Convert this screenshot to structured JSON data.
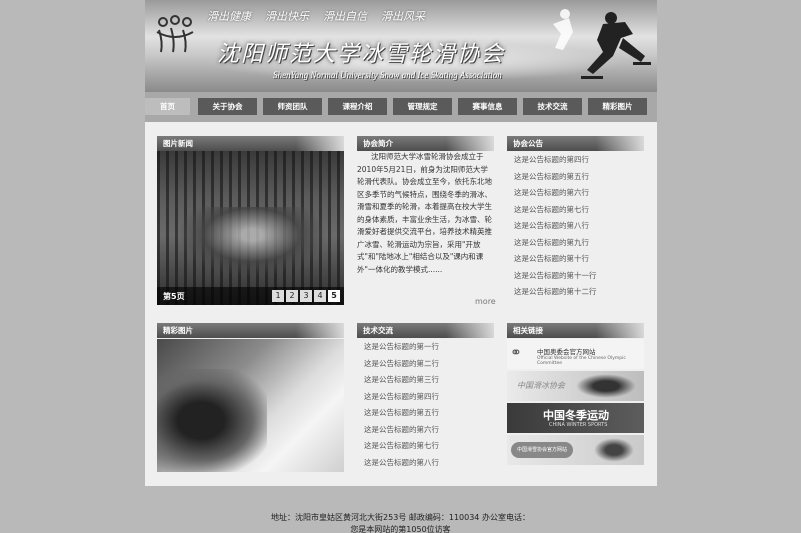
{
  "banner": {
    "slogans": [
      "滑出健康",
      "滑出快乐",
      "滑出自信",
      "滑出风采"
    ],
    "title": "沈阳师范大学冰雪轮滑协会",
    "subtitle": "ShenYang Normal University Snow and Ice Skating Association"
  },
  "nav": {
    "items": [
      {
        "label": "首页",
        "active": true
      },
      {
        "label": "关于协会"
      },
      {
        "label": "师资团队"
      },
      {
        "label": "课程介绍"
      },
      {
        "label": "管理规定"
      },
      {
        "label": "赛事信息"
      },
      {
        "label": "技术交流"
      },
      {
        "label": "精彩图片"
      }
    ]
  },
  "news_photo": {
    "heading": "图片新闻",
    "page_label": "第5页",
    "pages": [
      "1",
      "2",
      "3",
      "4",
      "5"
    ]
  },
  "intro": {
    "heading": "协会简介",
    "text": "沈阳师范大学冰雪轮滑协会成立于2010年5月21日，前身为沈阳师范大学轮滑代表队。协会成立至今，依托东北地区多季节的气候特点，围绕冬季的滑冰、滑雪和夏季的轮滑，本着提高在校大学生的身体素质，丰富业余生活，为冰雪、轮滑爱好者提供交流平台，培养技术精英推广冰雪、轮滑运动为宗旨，采用\"开放式\"和\"陆地冰上\"相结合以及\"课内和课外\"一体化的教学模式......",
    "more": "more"
  },
  "announcements": {
    "heading": "协会公告",
    "items": [
      "这是公告标题的第四行",
      "这是公告标题的第五行",
      "这是公告标题的第六行",
      "这是公告标题的第七行",
      "这是公告标题的第八行",
      "这是公告标题的第九行",
      "这是公告标题的第十行",
      "这是公告标题的第十一行",
      "这是公告标题的第十二行"
    ]
  },
  "gallery": {
    "heading": "精彩图片"
  },
  "tech": {
    "heading": "技术交流",
    "items": [
      "这是公告标题的第一行",
      "这是公告标题的第二行",
      "这是公告标题的第三行",
      "这是公告标题的第四行",
      "这是公告标题的第五行",
      "这是公告标题的第六行",
      "这是公告标题的第七行",
      "这是公告标题的第八行"
    ]
  },
  "links": {
    "heading": "相关链接",
    "olympic_cn": "中国奥委会官方网站",
    "olympic_en": "Official Website of the Chinese Olympic Committee",
    "skating": "中国滑冰协会",
    "winter_cn": "中国冬季运动",
    "winter_en": "CHINA WINTER SPORTS",
    "skiing": "中国滑雪协会官方网站"
  },
  "footer": {
    "line1": "地址：沈阳市皇姑区黄河北大街253号 邮政编码：110034 办公室电话：",
    "line2": "您是本网站的第1050位访客"
  }
}
